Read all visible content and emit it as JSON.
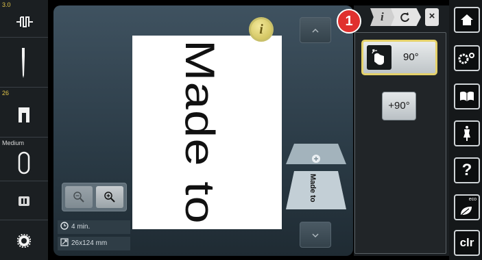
{
  "left_sidebar": {
    "stitch_width_value": "3.0",
    "needle_label": "",
    "presser_foot_value": "26",
    "tension_label": "Medium"
  },
  "canvas": {
    "motif_text": "Made to"
  },
  "layers": {
    "thumbnail_text": "Made to"
  },
  "status": {
    "time": "4 min.",
    "size": "26x124 mm"
  },
  "breadcrumb": {
    "info_label": "i",
    "close_label": "×"
  },
  "badge": {
    "number": "1"
  },
  "rotate": {
    "rotate_label": "90°",
    "rotate_plus_label": "+90°"
  },
  "right_buttons": {
    "clr_label": "clr",
    "help_label": "?",
    "eco_label": "eco"
  },
  "info_button_label": "i"
}
